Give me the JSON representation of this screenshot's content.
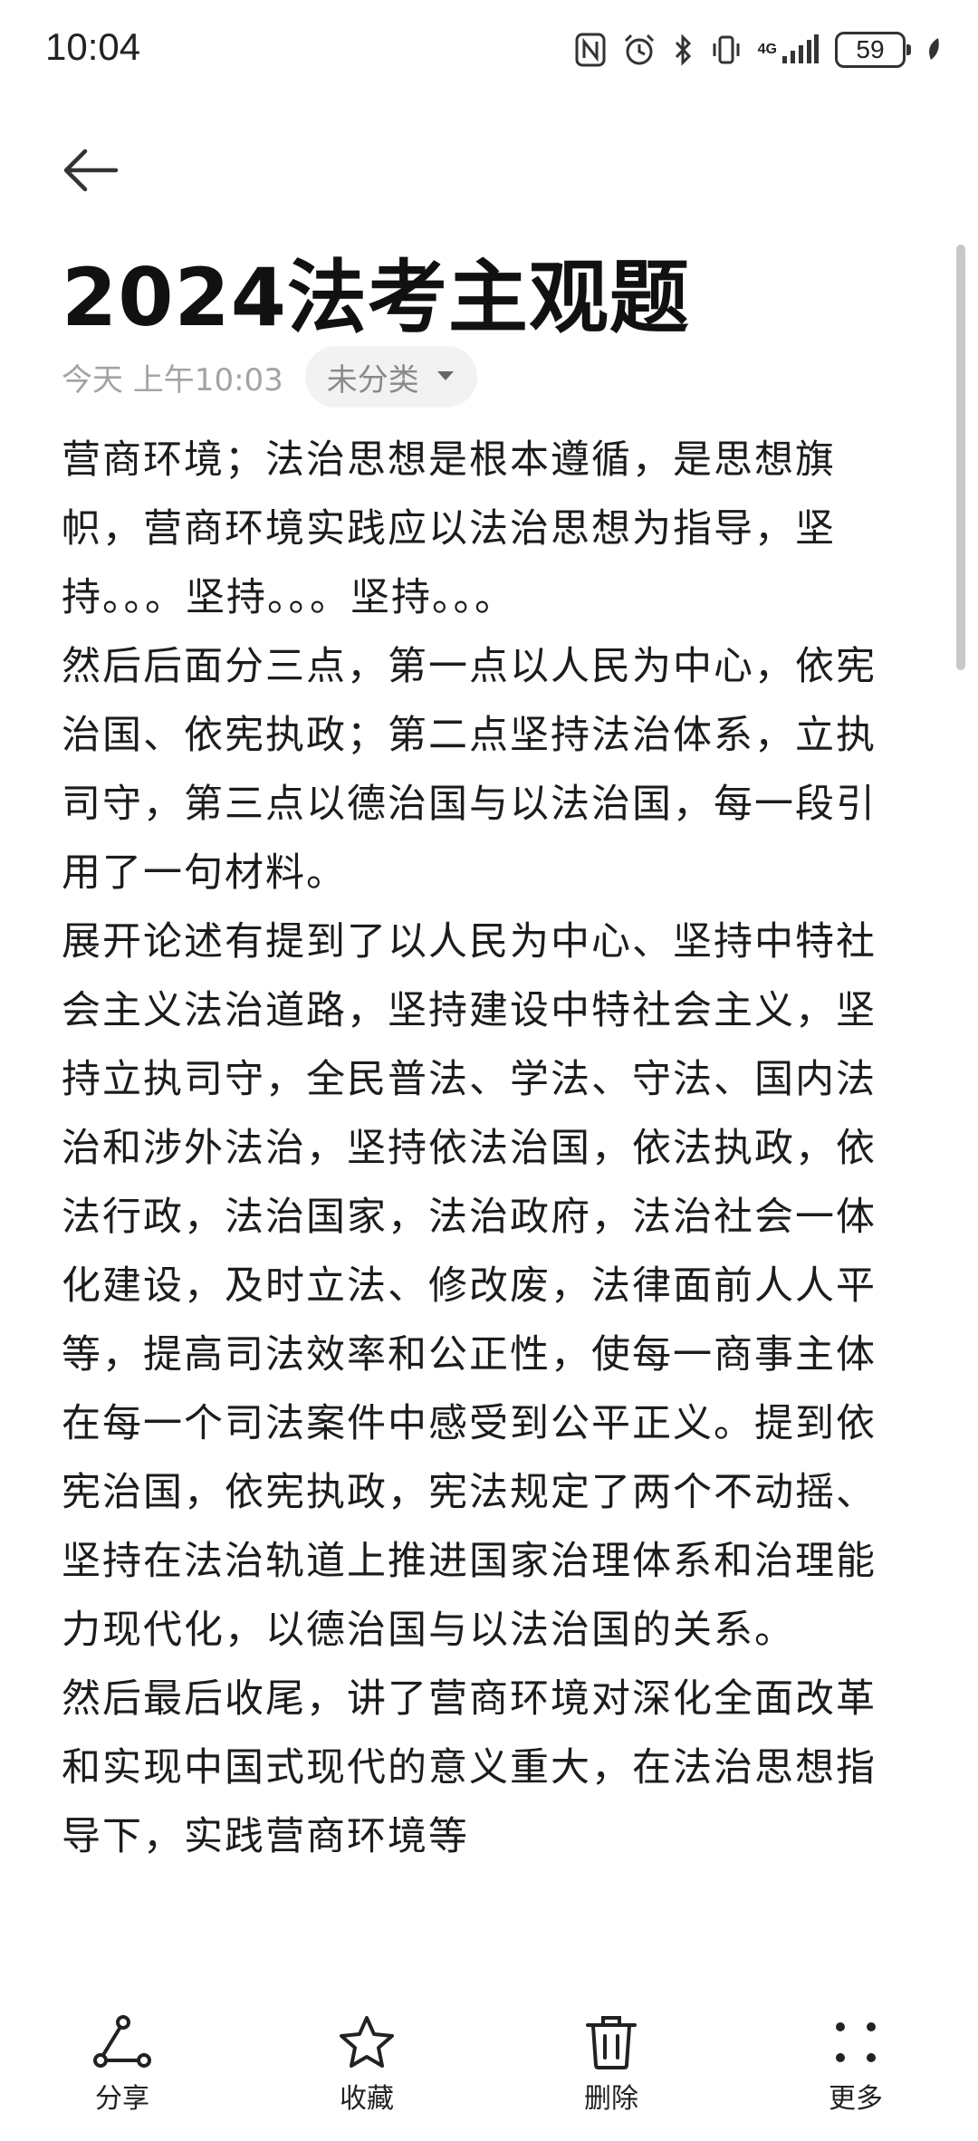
{
  "status_bar": {
    "time": "10:04",
    "battery": "59",
    "network": "4G"
  },
  "note": {
    "title": "2024法考主观题",
    "date": "今天 上午10:03",
    "category": "未分类",
    "paragraphs": [
      "营商环境；法治思想是根本遵循，是思想旗帜，营商环境实践应以法治思想为指导，坚持。。。坚持。。。坚持。。。",
      "然后后面分三点，第一点以人民为中心，依宪治国、依宪执政；第二点坚持法治体系，立执司守，第三点以德治国与以法治国，每一段引用了一句材料。",
      "展开论述有提到了以人民为中心、坚持中特社会主义法治道路，坚持建设中特社会主义，坚持立执司守，全民普法、学法、守法、国内法治和涉外法治，坚持依法治国，依法执政，依法行政，法治国家，法治政府，法治社会一体化建设，及时立法、修改废，法律面前人人平等，提高司法效率和公正性，使每一商事主体在每一个司法案件中感受到公平正义。提到依宪治国，依宪执政，宪法规定了两个不动摇、坚持在法治轨道上推进国家治理体系和治理能力现代化，以德治国与以法治国的关系。",
      "然后最后收尾，讲了营商环境对深化全面改革和实现中国式现代的意义重大，在法治思想指导下，实践营商环境等"
    ]
  },
  "toolbar": {
    "share": "分享",
    "favorite": "收藏",
    "delete": "删除",
    "more": "更多"
  },
  "icons": {
    "back": "arrow-left-icon",
    "share": "share-icon",
    "favorite": "star-icon",
    "delete": "trash-icon",
    "more": "more-dots-icon"
  }
}
